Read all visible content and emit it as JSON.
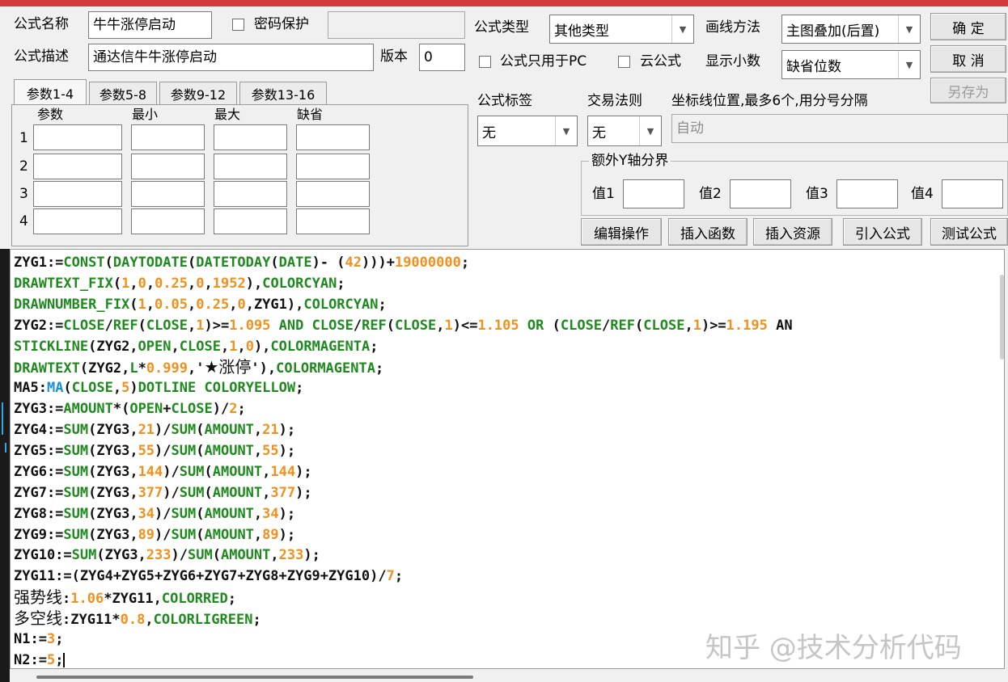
{
  "form": {
    "name_label": "公式名称",
    "name_value": "牛牛涨停启动",
    "password_label": "密码保护",
    "password_value": "",
    "desc_label": "公式描述",
    "desc_value": "通达信牛牛涨停启动",
    "version_label": "版本",
    "version_value": "0",
    "type_label": "公式类型",
    "type_value": "其他类型",
    "draw_method_label": "画线方法",
    "draw_method_value": "主图叠加(后置)",
    "pc_only_label": "公式只用于PC",
    "cloud_label": "云公式",
    "decimals_label": "显示小数",
    "decimals_value": "缺省位数",
    "tag_label": "公式标签",
    "tag_value": "无",
    "trade_rule_label": "交易法则",
    "trade_rule_value": "无",
    "axis_label": "坐标线位置,最多6个,用分号分隔",
    "axis_value": "自动"
  },
  "buttons": {
    "ok": "确 定",
    "cancel": "取 消",
    "save_as": "另存为",
    "edit_ops": "编辑操作",
    "insert_func": "插入函数",
    "insert_res": "插入资源",
    "import_formula": "引入公式",
    "test_formula": "测试公式"
  },
  "params": {
    "tabs": [
      "参数1-4",
      "参数5-8",
      "参数9-12",
      "参数13-16"
    ],
    "headers": [
      "参数",
      "最小",
      "最大",
      "缺省"
    ],
    "rows": [
      "1",
      "2",
      "3",
      "4"
    ]
  },
  "y_axis": {
    "title": "额外Y轴分界",
    "labels": [
      "值1",
      "值2",
      "值3",
      "值4"
    ]
  },
  "code": [
    "ZYG1:=CONST(DAYTODATE(DATETODAY(DATE)- (42)))+19000000;",
    "DRAWTEXT_FIX(1,0,0.25,0,1952),COLORCYAN;",
    "DRAWNUMBER_FIX(1,0.05,0.25,0,ZYG1),COLORCYAN;",
    "ZYG2:=CLOSE/REF(CLOSE,1)>=1.095 AND CLOSE/REF(CLOSE,1)<=1.105 OR (CLOSE/REF(CLOSE,1)>=1.195 AN",
    "STICKLINE(ZYG2,OPEN,CLOSE,1,0),COLORMAGENTA;",
    "DRAWTEXT(ZYG2,L*0.999,'★涨停'),COLORMAGENTA;",
    "MA5:MA(CLOSE,5)DOTLINE COLORYELLOW;",
    "ZYG3:=AMOUNT*(OPEN+CLOSE)/2;",
    "ZYG4:=SUM(ZYG3,21)/SUM(AMOUNT,21);",
    "ZYG5:=SUM(ZYG3,55)/SUM(AMOUNT,55);",
    "ZYG6:=SUM(ZYG3,144)/SUM(AMOUNT,144);",
    "ZYG7:=SUM(ZYG3,377)/SUM(AMOUNT,377);",
    "ZYG8:=SUM(ZYG3,34)/SUM(AMOUNT,34);",
    "ZYG9:=SUM(ZYG3,89)/SUM(AMOUNT,89);",
    "ZYG10:=SUM(ZYG3,233)/SUM(AMOUNT,233);",
    "ZYG11:=(ZYG4+ZYG5+ZYG6+ZYG7+ZYG8+ZYG9+ZYG10)/7;",
    "强势线:1.06*ZYG11,COLORRED;",
    "多空线:ZYG11*0.8,COLORLIGREEN;",
    "N1:=3;",
    "N2:=5;"
  ],
  "watermark": "知乎 @技术分析代码",
  "colors": {
    "function": "#1e8a1e",
    "number": "#f0901d",
    "ma_keyword": "#1a8fd6",
    "title_bar": "#d23b3b"
  },
  "icons": {
    "dropdown": "chevron-down-icon",
    "checkbox": "checkbox-icon"
  }
}
